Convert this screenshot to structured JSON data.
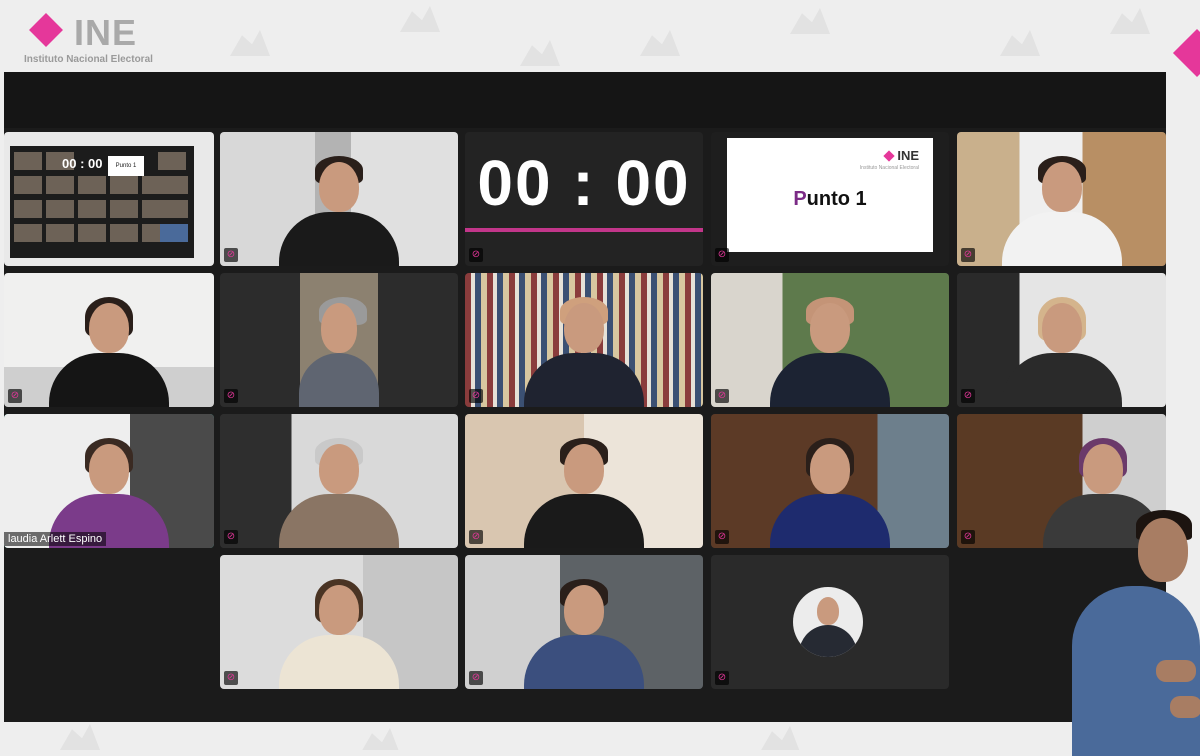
{
  "brand": {
    "wordmark": "INE",
    "subtitle": "Instituto Nacional Electoral",
    "accent": "#e5379a"
  },
  "meeting": {
    "timer": "00 : 00",
    "timer_progress": 1.0,
    "slide": {
      "logo": "INE",
      "logo_sub": "Instituto Nacional Electoral",
      "title_first": "P",
      "title_rest": "unto 1"
    },
    "mini_grid": {
      "timer": "00 : 00",
      "slide": "Punto 1"
    },
    "participants": [
      {
        "id": "r1c1",
        "kind": "gallery-thumbnail"
      },
      {
        "id": "r1c2",
        "kind": "video"
      },
      {
        "id": "r1c3",
        "kind": "timer"
      },
      {
        "id": "r1c4",
        "kind": "slide"
      },
      {
        "id": "r1c5",
        "kind": "video"
      },
      {
        "id": "r2c1",
        "kind": "video"
      },
      {
        "id": "r2c2",
        "kind": "video"
      },
      {
        "id": "r2c3",
        "kind": "video"
      },
      {
        "id": "r2c4",
        "kind": "video"
      },
      {
        "id": "r2c5",
        "kind": "video"
      },
      {
        "id": "r3c1",
        "kind": "video",
        "name": "laudia Arlett Espino",
        "active_speaker": true
      },
      {
        "id": "r3c2",
        "kind": "video"
      },
      {
        "id": "r3c3",
        "kind": "video"
      },
      {
        "id": "r3c4",
        "kind": "video"
      },
      {
        "id": "r3c5",
        "kind": "video"
      },
      {
        "id": "r4c2",
        "kind": "video"
      },
      {
        "id": "r4c3",
        "kind": "video"
      },
      {
        "id": "r4c4",
        "kind": "avatar"
      }
    ],
    "active_speaker_color": "#2fb3a6",
    "mic_icon": "mic-muted-icon"
  },
  "sign_language_interpreter": {
    "present": true
  }
}
